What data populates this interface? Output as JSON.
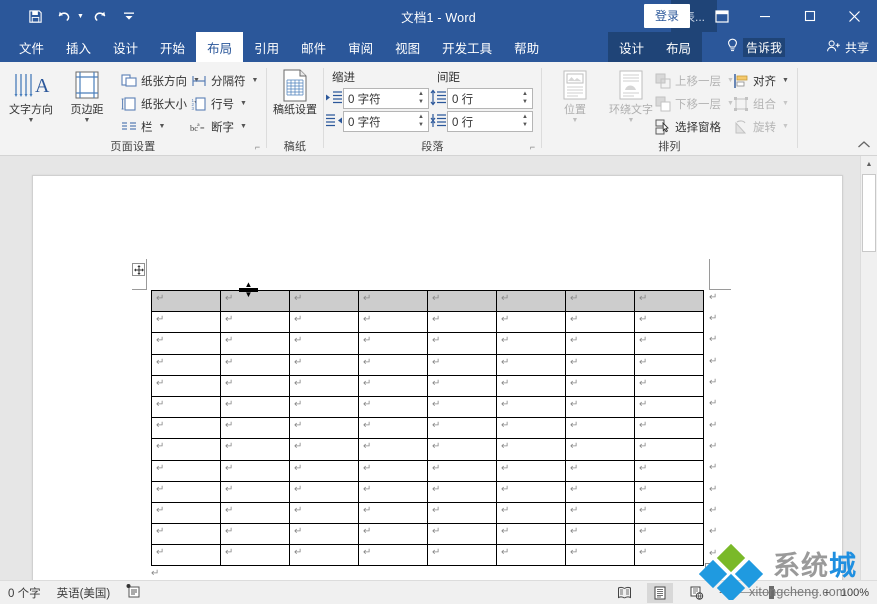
{
  "titlebar": {
    "document_title": "文档1  -  Word",
    "qat": [
      {
        "name": "save",
        "icon": "save-icon"
      },
      {
        "name": "undo",
        "icon": "undo-icon"
      },
      {
        "name": "redo",
        "icon": "redo-icon"
      },
      {
        "name": "customize",
        "icon": "customize-qat-icon"
      }
    ],
    "contextual_group_label": "表...",
    "signin_label": "登录",
    "ribbon_display_icon": "ribbon-display-options-icon",
    "minimize_icon": "minimize-icon",
    "maximize_icon": "maximize-icon",
    "close_icon": "close-icon"
  },
  "tabs": [
    {
      "label": "文件",
      "active": false
    },
    {
      "label": "插入",
      "active": false
    },
    {
      "label": "设计",
      "active": false
    },
    {
      "label": "开始",
      "active": false
    },
    {
      "label": "布局",
      "active": true
    },
    {
      "label": "引用",
      "active": false
    },
    {
      "label": "邮件",
      "active": false
    },
    {
      "label": "审阅",
      "active": false
    },
    {
      "label": "视图",
      "active": false
    },
    {
      "label": "开发工具",
      "active": false
    },
    {
      "label": "帮助",
      "active": false
    }
  ],
  "contextual_tabs": [
    {
      "label": "设计",
      "active": false
    },
    {
      "label": "布局",
      "active": false
    }
  ],
  "tell_me": {
    "label": "告诉我",
    "icon": "lightbulb-icon"
  },
  "share": {
    "label": "共享",
    "icon": "share-person-icon"
  },
  "ribbon": {
    "collapse_icon": "collapse-ribbon-icon",
    "groups": [
      {
        "name": "page-setup",
        "label": "页面设置",
        "dialog_launcher": true,
        "big_buttons": [
          {
            "label": "文字方向",
            "icon": "text-direction-icon",
            "has_dropdown": true,
            "disabled": false
          },
          {
            "label": "页边距",
            "icon": "margins-icon",
            "has_dropdown": true,
            "disabled": false
          }
        ],
        "small_buttons": [
          {
            "label": "纸张方向",
            "icon": "orientation-icon",
            "has_dropdown": true
          },
          {
            "label": "纸张大小",
            "icon": "paper-size-icon",
            "has_dropdown": true
          },
          {
            "label": "栏",
            "icon": "columns-icon",
            "has_dropdown": true
          },
          {
            "label": "分隔符",
            "icon": "breaks-icon",
            "has_dropdown": true
          },
          {
            "label": "行号",
            "icon": "line-numbers-icon",
            "has_dropdown": true
          },
          {
            "label": "断字",
            "icon": "hyphenation-icon",
            "has_dropdown": true
          }
        ]
      },
      {
        "name": "manuscript",
        "label": "稿纸",
        "dialog_launcher": false,
        "big_buttons": [
          {
            "label": "稿纸设置",
            "icon": "manuscript-settings-icon",
            "has_dropdown": false,
            "disabled": false
          }
        ],
        "small_buttons": []
      },
      {
        "name": "paragraph",
        "label": "段落",
        "dialog_launcher": true,
        "column_headers": [
          "缩进",
          "间距"
        ],
        "fields": [
          {
            "name": "indent-left",
            "icon": "indent-left-icon",
            "value": "0 字符"
          },
          {
            "name": "indent-right",
            "icon": "indent-right-icon",
            "value": "0 字符"
          },
          {
            "name": "spacing-before",
            "icon": "spacing-before-icon",
            "value": "0 行"
          },
          {
            "name": "spacing-after",
            "icon": "spacing-after-icon",
            "value": "0 行"
          }
        ]
      },
      {
        "name": "arrange",
        "label": "排列",
        "dialog_launcher": false,
        "big_buttons": [
          {
            "label": "位置",
            "icon": "position-icon",
            "has_dropdown": true,
            "disabled": true
          },
          {
            "label": "环绕文字",
            "icon": "wrap-text-icon",
            "has_dropdown": true,
            "disabled": true
          }
        ],
        "small_buttons": [
          {
            "label": "上移一层",
            "icon": "bring-forward-icon",
            "has_dropdown": true,
            "disabled": true
          },
          {
            "label": "下移一层",
            "icon": "send-backward-icon",
            "has_dropdown": true,
            "disabled": true
          },
          {
            "label": "选择窗格",
            "icon": "selection-pane-icon",
            "has_dropdown": false,
            "disabled": false
          },
          {
            "label": "对齐",
            "icon": "align-icon",
            "has_dropdown": true,
            "disabled": false
          },
          {
            "label": "组合",
            "icon": "group-icon",
            "has_dropdown": true,
            "disabled": true
          },
          {
            "label": "旋转",
            "icon": "rotate-icon",
            "has_dropdown": true,
            "disabled": true
          }
        ]
      }
    ]
  },
  "document": {
    "table": {
      "columns": 8,
      "rows": 13,
      "selected_row_index": 0,
      "cell_mark": "↵",
      "end_of_row_mark": "↵",
      "paragraph_mark_below": "↵",
      "move_handle_icon": "table-move-handle-icon",
      "resize_handle_icon": "table-resize-handle-icon",
      "cursor_icon": "row-resize-cursor-icon"
    }
  },
  "statusbar": {
    "word_count": "0 个字",
    "language": "英语(美国)",
    "proofing_icon": "proofing-errors-icon",
    "views": [
      {
        "name": "read-mode",
        "icon": "read-mode-icon",
        "active": false
      },
      {
        "name": "print-layout",
        "icon": "print-layout-icon",
        "active": true
      },
      {
        "name": "web-layout",
        "icon": "web-layout-icon",
        "active": false
      }
    ],
    "zoom_out_icon": "zoom-out-icon",
    "zoom_in_icon": "zoom-in-icon",
    "zoom_value": "100%"
  },
  "watermark": {
    "brand": "系统",
    "brand_accent": "城",
    "url": "xitongcheng.com",
    "logo_icon": "diamond-logo-icon",
    "colors": {
      "blue": "#1f8fe0",
      "green": "#7ab929",
      "gray": "#9a9a9a"
    }
  },
  "colors": {
    "word_blue": "#2b579a",
    "contextual_dark": "#1f4477",
    "ribbon_bg": "#f3f3f3",
    "doc_bg": "#e6e6e6",
    "selection_gray": "#cdcdcd"
  }
}
